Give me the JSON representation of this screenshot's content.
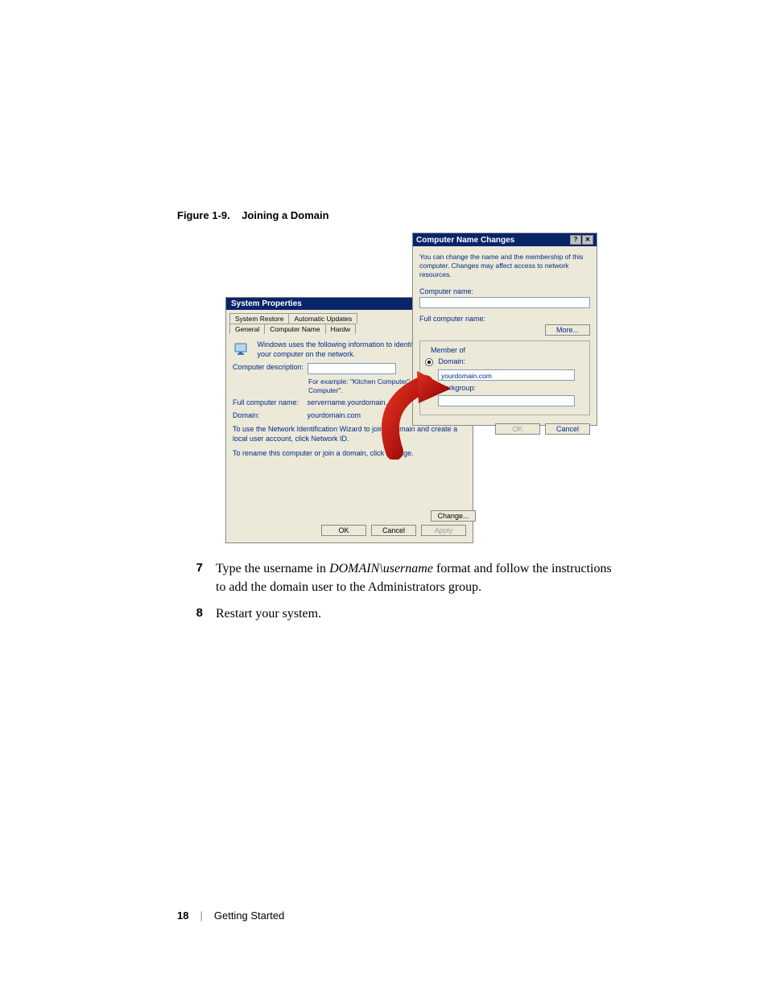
{
  "figure": {
    "caption_prefix": "Figure 1-9.",
    "caption_title": "Joining a Domain"
  },
  "system_properties": {
    "title": "System Properties",
    "tabs_row1": [
      "System Restore",
      "Automatic Updates"
    ],
    "tabs_row2": [
      "General",
      "Computer Name",
      "Hardw"
    ],
    "active_tab": "Computer Name",
    "info_text": "Windows uses the following information to identify your computer on the network.",
    "desc_label": "Computer description:",
    "desc_hint": "For example: \"Kitchen Computer\" or \"Mary's Computer\".",
    "full_name_label": "Full computer name:",
    "full_name_value": "servername.yourdomain.",
    "domain_label": "Domain:",
    "domain_value": "yourdomain.com",
    "netid_text": "To use the Network Identification Wizard to join a domain and create a local user account, click Network ID.",
    "rename_text": "To rename this computer or join a domain, click Change.",
    "change_btn": "Change...",
    "ok_btn": "OK",
    "cancel_btn": "Cancel",
    "apply_btn": "Apply"
  },
  "cnc": {
    "title": "Computer Name Changes",
    "desc": "You can change the name and the membership of this computer. Changes may affect access to network resources.",
    "computer_name_label": "Computer name:",
    "full_name_label": "Full computer name:",
    "more_btn": "More...",
    "member_of": "Member of",
    "domain_label": "Domain:",
    "domain_value": "yourdomain.com",
    "workgroup_label": "Workgroup:",
    "ok_btn": "OK",
    "cancel_btn": "Cancel",
    "help_btn": "?",
    "close_btn": "✕"
  },
  "steps": {
    "s7_num": "7",
    "s7_a": "Type the username in ",
    "s7_italic": "DOMAIN\\username",
    "s7_b": " format and follow the instructions to add the domain user to the Administrators group.",
    "s8_num": "8",
    "s8_text": "Restart your system."
  },
  "footer": {
    "page_number": "18",
    "separator": "|",
    "section": "Getting Started"
  }
}
